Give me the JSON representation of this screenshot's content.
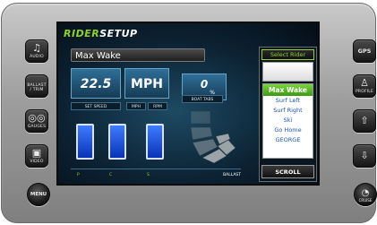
{
  "brand": {
    "part1": "RIDER",
    "part2": "SETUP"
  },
  "rider": {
    "name": "Max Wake"
  },
  "readouts": {
    "speed": "22.5",
    "unit": "MPH",
    "tab_value": "0",
    "tab_unit": "%"
  },
  "labels": {
    "set_speed": "SET SPEED",
    "mph": "MPH",
    "rpm": "RPM",
    "boat_tabs": "BOAT TABS"
  },
  "ballast": {
    "port": "P",
    "center": "C",
    "starboard": "S",
    "label": "BALLAST"
  },
  "rider_panel": {
    "header": "Select Rider",
    "selected": "Max Wake",
    "options": [
      "Surf Left",
      "Surf Right",
      "Ski",
      "Go Home",
      "GEORGE"
    ],
    "scroll": "SCROLL"
  },
  "left_buttons": {
    "audio": {
      "icon": "music-note-icon",
      "label": "AUDIO"
    },
    "ballast": {
      "label": "BALLAST / TRIM"
    },
    "gauges": {
      "icon": "gauge-icon",
      "label": "GAUGES"
    },
    "video": {
      "icon": "video-camera-icon",
      "label": "VIDEO"
    },
    "menu": {
      "label": "MENU"
    }
  },
  "right_buttons": {
    "gps": {
      "label": "GPS"
    },
    "profile": {
      "icon": "person-icon",
      "label": "PROFILE"
    },
    "up": {
      "icon": "arrow-up-icon"
    },
    "down": {
      "icon": "arrow-down-icon"
    },
    "cruise": {
      "icon": "speedometer-icon",
      "label": "CRUISE"
    }
  },
  "colors": {
    "accent_green": "#8fd22f",
    "selection_green": "#5cb824",
    "ballast_blue": "#1e5cff",
    "list_text": "#1c54b8"
  }
}
